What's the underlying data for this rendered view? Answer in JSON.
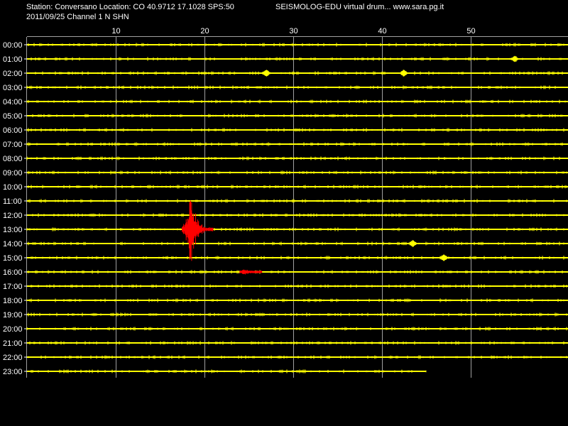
{
  "header": {
    "station_line": "Station: Conversano Location: CO 40.9712 17.1028 SPS:50",
    "date_line": "2011/09/25  Channel 1 N SHN",
    "app_line": "SEISMOLOG-EDU virtual drum... www.sara.pg.it"
  },
  "colors": {
    "background": "#000000",
    "trace": "#ffff00",
    "event": "#ff0000",
    "grid": "#a0a0a0",
    "text": "#ffffff"
  },
  "chart_data": {
    "type": "line",
    "title": "",
    "xlabel": "",
    "ylabel": "",
    "x_unit": "minutes",
    "xlim": [
      0,
      61
    ],
    "x_ticks": [
      10,
      20,
      30,
      40,
      50
    ],
    "grid": true,
    "rows": [
      "00:00",
      "01:00",
      "02:00",
      "03:00",
      "04:00",
      "05:00",
      "06:00",
      "07:00",
      "08:00",
      "09:00",
      "10:00",
      "11:00",
      "12:00",
      "13:00",
      "14:00",
      "15:00",
      "16:00",
      "17:00",
      "18:00",
      "19:00",
      "20:00",
      "21:00",
      "22:00",
      "23:00"
    ],
    "last_row_end_minute": 45,
    "events": [
      {
        "row": "13:00",
        "start": 17.5,
        "peak": 18.5,
        "end": 21.0,
        "amplitude_rows": 2.6
      },
      {
        "row": "16:00",
        "start": 24.0,
        "peak": 24.5,
        "end": 26.5,
        "amplitude_rows": 0.3
      }
    ],
    "minor_blips": [
      {
        "row": "01:00",
        "minute": 55.0
      },
      {
        "row": "02:00",
        "minute": 27.0
      },
      {
        "row": "02:00",
        "minute": 42.5
      },
      {
        "row": "14:00",
        "minute": 43.5
      },
      {
        "row": "15:00",
        "minute": 47.0
      }
    ]
  }
}
